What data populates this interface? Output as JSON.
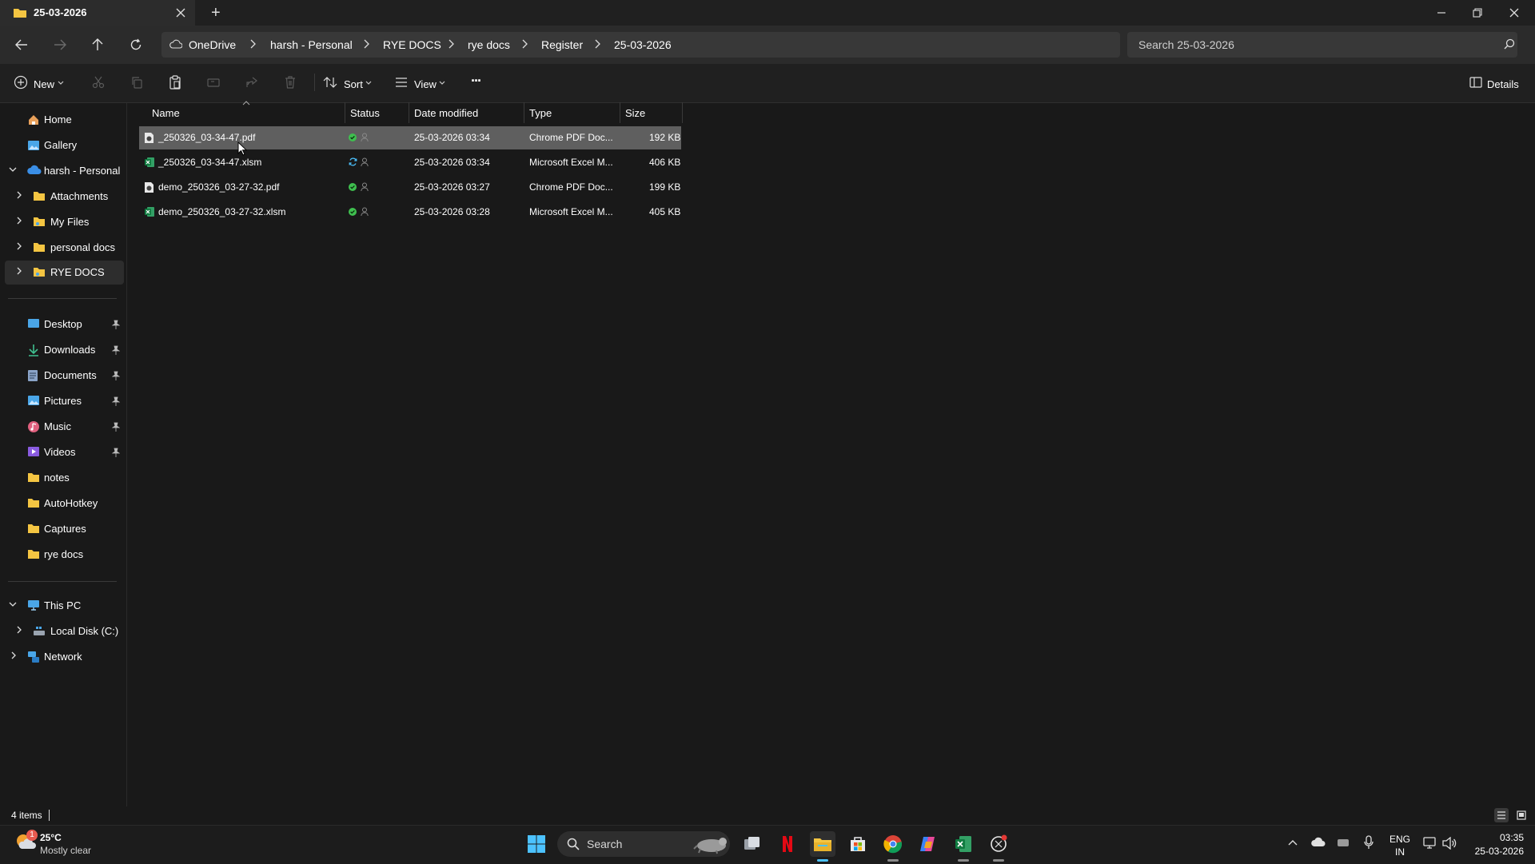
{
  "window": {
    "tab_title": "25-03-2026",
    "new_tab": "+"
  },
  "breadcrumb": [
    "OneDrive",
    "harsh - Personal",
    "RYE DOCS",
    "rye docs",
    "Register",
    "25-03-2026"
  ],
  "search": {
    "placeholder": "Search 25-03-2026"
  },
  "toolbar": {
    "new_label": "New",
    "sort_label": "Sort",
    "view_label": "View",
    "more_label": "···",
    "details_label": "Details"
  },
  "sidebar": {
    "group1": [
      {
        "label": "Home",
        "icon": "home-icon"
      },
      {
        "label": "Gallery",
        "icon": "gallery-icon"
      },
      {
        "label": "harsh - Personal",
        "icon": "cloud-icon"
      },
      {
        "label": "Attachments",
        "icon": "folder-icon"
      },
      {
        "label": "My Files",
        "icon": "folder-icon"
      },
      {
        "label": "personal docs",
        "icon": "folder-icon"
      },
      {
        "label": "RYE DOCS",
        "icon": "folder-icon"
      }
    ],
    "group2": [
      {
        "label": "Desktop",
        "icon": "desktop-icon"
      },
      {
        "label": "Downloads",
        "icon": "downloads-icon"
      },
      {
        "label": "Documents",
        "icon": "documents-icon"
      },
      {
        "label": "Pictures",
        "icon": "pictures-icon"
      },
      {
        "label": "Music",
        "icon": "music-icon"
      },
      {
        "label": "Videos",
        "icon": "videos-icon"
      },
      {
        "label": "notes",
        "icon": "folder-icon"
      },
      {
        "label": "AutoHotkey",
        "icon": "folder-icon"
      },
      {
        "label": "Captures",
        "icon": "folder-icon"
      },
      {
        "label": "rye docs",
        "icon": "folder-icon"
      }
    ],
    "group3": [
      {
        "label": "This PC",
        "icon": "pc-icon"
      },
      {
        "label": "Local Disk (C:)",
        "icon": "disk-icon"
      },
      {
        "label": "Network",
        "icon": "network-icon"
      }
    ]
  },
  "columns": {
    "name": "Name",
    "status": "Status",
    "date": "Date modified",
    "type": "Type",
    "size": "Size"
  },
  "files": [
    {
      "name": "_250326_03-34-47.pdf",
      "date": "25-03-2026 03:34",
      "type": "Chrome PDF Doc...",
      "size": "192 KB",
      "status": "synced"
    },
    {
      "name": "_250326_03-34-47.xlsm",
      "date": "25-03-2026 03:34",
      "type": "Microsoft Excel M...",
      "size": "406 KB",
      "status": "syncing"
    },
    {
      "name": "demo_250326_03-27-32.pdf",
      "date": "25-03-2026 03:27",
      "type": "Chrome PDF Doc...",
      "size": "199 KB",
      "status": "synced"
    },
    {
      "name": "demo_250326_03-27-32.xlsm",
      "date": "25-03-2026 03:28",
      "type": "Microsoft Excel M...",
      "size": "405 KB",
      "status": "synced"
    }
  ],
  "statusbar": {
    "item_count": "4 items"
  },
  "taskbar": {
    "weather_temp": "25°C",
    "weather_desc": "Mostly clear",
    "weather_badge": "1",
    "search_label": "Search",
    "lang_top": "ENG",
    "lang_bottom": "IN",
    "time": "03:35",
    "date": "25-03-2026"
  },
  "colors": {
    "accent": "#4cc2ff",
    "folder": "#f4c542",
    "sync_ok": "#3fbf4f",
    "selected_row": "#5f5f5f"
  }
}
